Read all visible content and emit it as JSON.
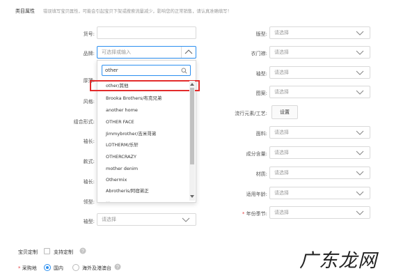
{
  "header": {
    "section_label": "类目属性",
    "notice": "错误填写宝贝属性，可能会引起宝贝下架或搜索流量减少，影响您的正常销售，请认真准确填写！"
  },
  "left_fields": {
    "huohao": "货号:",
    "pinpai": "品牌:",
    "pinpai_placeholder": "可选择或输入",
    "houdu": "厚薄:",
    "fengge": "风格:",
    "zuhe": "组合形式:",
    "xiuchang": "袖长:",
    "kuanshi": "款式:",
    "xiuxing": "袖长:",
    "lingxing": "领型:",
    "xiuxing2": "袖型:",
    "xiuxing2_placeholder": "请选择"
  },
  "brand_dropdown": {
    "search_value": "other",
    "items": [
      "other/其他",
      "Brooka Brothers/布克兄弟",
      "another home",
      "OTHER FACE",
      "Jimmybrother/吉米哥弟",
      "LOTHERM/乐轩",
      "OTHERCRAZY",
      "mother denim",
      "Othermix",
      "Abrotheris/阿宿弟正"
    ],
    "cut_item": "..."
  },
  "right_fields": {
    "banxing": "版型:",
    "yimenjin": "衣门襟:",
    "xiuxing_r": "袖型:",
    "tuan": "图案:",
    "liuxing": "流行元素/工艺:",
    "liuxing_btn": "设置",
    "mianliao": "面料:",
    "chengfen": "成分含量:",
    "caizhi": "材质:",
    "nianling": "适用年龄:",
    "jijie": "年份季节:",
    "placeholder": "请选择"
  },
  "bottom": {
    "custom_label": "宝贝定制",
    "custom_checkbox": "支持定制",
    "purchase_label": "采购地",
    "radio_domestic": "国内",
    "radio_overseas": "海外及港澳台"
  },
  "watermark": "广东龙网",
  "colors": {
    "accent": "#2a8ef0",
    "highlight_box": "#e32b2b",
    "required": "#e4393c"
  }
}
